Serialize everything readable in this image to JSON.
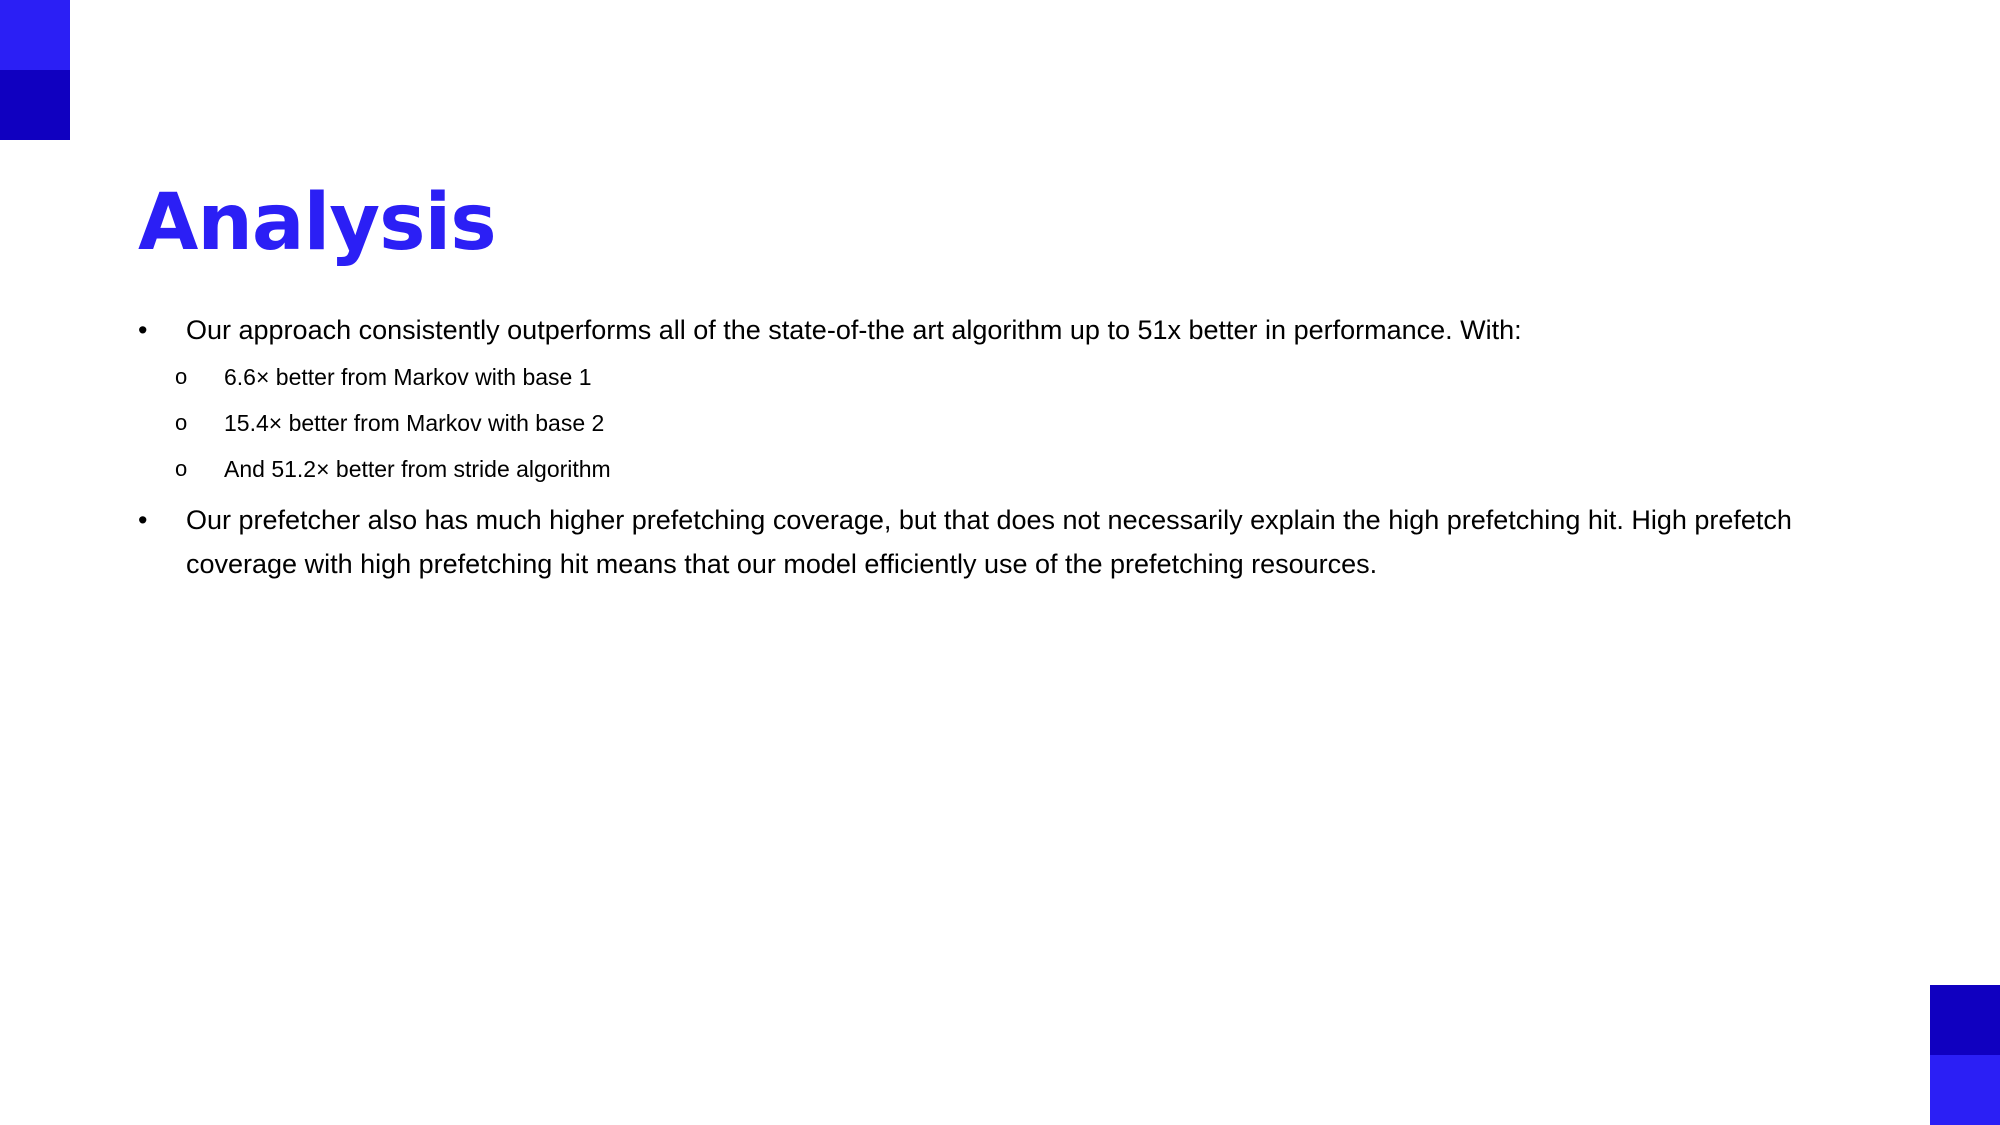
{
  "colors": {
    "accent": "#2b1ff5",
    "accent_dark": "#1000c0",
    "text": "#000000",
    "background": "#ffffff"
  },
  "slide": {
    "title": "Analysis",
    "bullets": [
      {
        "marker": "•",
        "text": "Our approach consistently outperforms all of the state-of-the art algorithm up to 51x better in performance. With:",
        "subitems": [
          {
            "marker": "o",
            "text": "6.6× better from Markov with base 1"
          },
          {
            "marker": "o",
            "text": "15.4× better from Markov with base 2"
          },
          {
            "marker": "o",
            "text": "And 51.2× better from stride algorithm"
          }
        ]
      },
      {
        "marker": "•",
        "text": "Our prefetcher also has much higher prefetching coverage, but that does not necessarily explain the high prefetching hit. High prefetch coverage with high prefetching hit means that our model efficiently use of the prefetching resources."
      }
    ]
  }
}
